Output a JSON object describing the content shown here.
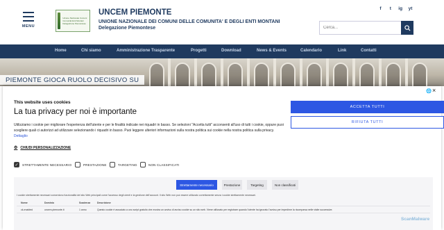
{
  "header": {
    "menu_label": "MENU",
    "logo_text": "Unione Nazionale Comuni Comunità Enti Montani Delegazione Piemontese",
    "title": "UNCEM PIEMONTE",
    "subtitle": "UNIONE NAZIONALE DEI COMUNI DELLE COMUNITA' E DEGLI ENTI MONTANI",
    "delegation": "Delegazione Piemontese",
    "socials": [
      "f",
      "t",
      "ig",
      "yt"
    ],
    "search": {
      "placeholder": "Cerca..."
    }
  },
  "nav": {
    "items": [
      "Home",
      "Chi siamo",
      "Amministrazione Trasparente",
      "Progetti",
      "Download",
      "News & Events",
      "Calendario",
      "Link",
      "Contatti"
    ]
  },
  "hero": {
    "headline": "PIEMONTE GIOCA RUOLO DECISIVO SU"
  },
  "cookie": {
    "title": "This website uses cookies",
    "heading": "La tua privacy per noi è importante",
    "body": "Utilizziamo i cookie per migliorare l'esperienza dell'utente e per le finalità indicate nei riquadri in basso. Se selezioni \"Accetta tutti\" acconsenti all'uso di tutti i cookie, oppure puoi scegliere quali ci autorizzi ad utilizzare selezionando i riquadri in basso. Puoi leggere ulteriori informazioni sulla nostra politica sui cookie nella nostra politica sulla privacy.",
    "details_link": "Dettaglio",
    "personalize": "CHIUDI PERSONALIZZAZIONE",
    "accept_label": "ACCETTA TUTTI",
    "reject_label": "RIFIUTA TUTTI",
    "checkboxes": [
      {
        "label": "STRETTAMENTE NECESSARIO",
        "checked": true
      },
      {
        "label": "PRESTAZIONE",
        "checked": false
      },
      {
        "label": "TARGETING",
        "checked": false
      },
      {
        "label": "NON CLASSIFICATI",
        "checked": false
      }
    ],
    "tabs": [
      "Strettamente necessario",
      "Prestazione",
      "Targeting",
      "Non classificati"
    ],
    "active_tab": 0,
    "panel_desc": "I cookie strettamente necessari consentono funzionalità del sito Web principali come l'accesso degli utenti e la gestione dell'account. Il sito Web non può essere utilizzato correttamente senza i cookie strettamente necessari.",
    "table": {
      "headers": [
        "Nome",
        "Dominio",
        "Scadenza",
        "Descrizione"
      ],
      "rows": [
        [
          "ck-enabled",
          "uncem.piemonte.it",
          "1 anno",
          "Questo cookie è associato a uno script gratuito che mostra un avviso di avviso cookie su un sito web. Viene utilizzato per registrare quando l'utente ha ignorato l'avviso per impedirne la ricomparsa nelle visite successive."
        ]
      ]
    }
  },
  "watermark": "ScanMalware"
}
